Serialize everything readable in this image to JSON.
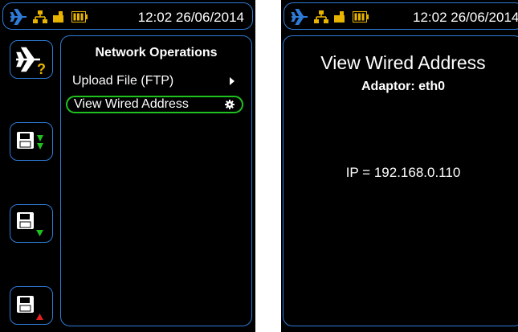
{
  "colors": {
    "accent_blue": "#2e7bd6",
    "select_green": "#1fc01f",
    "battery_yellow": "#e8b400",
    "background": "#000000",
    "text": "#ffffff"
  },
  "status_bar": {
    "time": "12:02 26/06/2014",
    "icons": [
      "airplane-icon",
      "network-icon",
      "usb-battery-icon",
      "battery-level-icon"
    ]
  },
  "left_screen": {
    "side_buttons": [
      {
        "icon": "airplane-help-icon"
      },
      {
        "icon": "save-down-green-icon"
      },
      {
        "icon": "save-down-icon"
      },
      {
        "icon": "save-up-red-icon"
      }
    ],
    "menu": {
      "title": "Network Operations",
      "items": [
        {
          "label": "Upload File (FTP)",
          "icon": "arrow-right-icon",
          "selected": false
        },
        {
          "label": "View Wired Address",
          "icon": "gear-icon",
          "selected": true
        }
      ]
    }
  },
  "right_screen": {
    "title": "View Wired Address",
    "adaptor": "Adaptor: eth0",
    "ip": "IP = 192.168.0.110"
  }
}
